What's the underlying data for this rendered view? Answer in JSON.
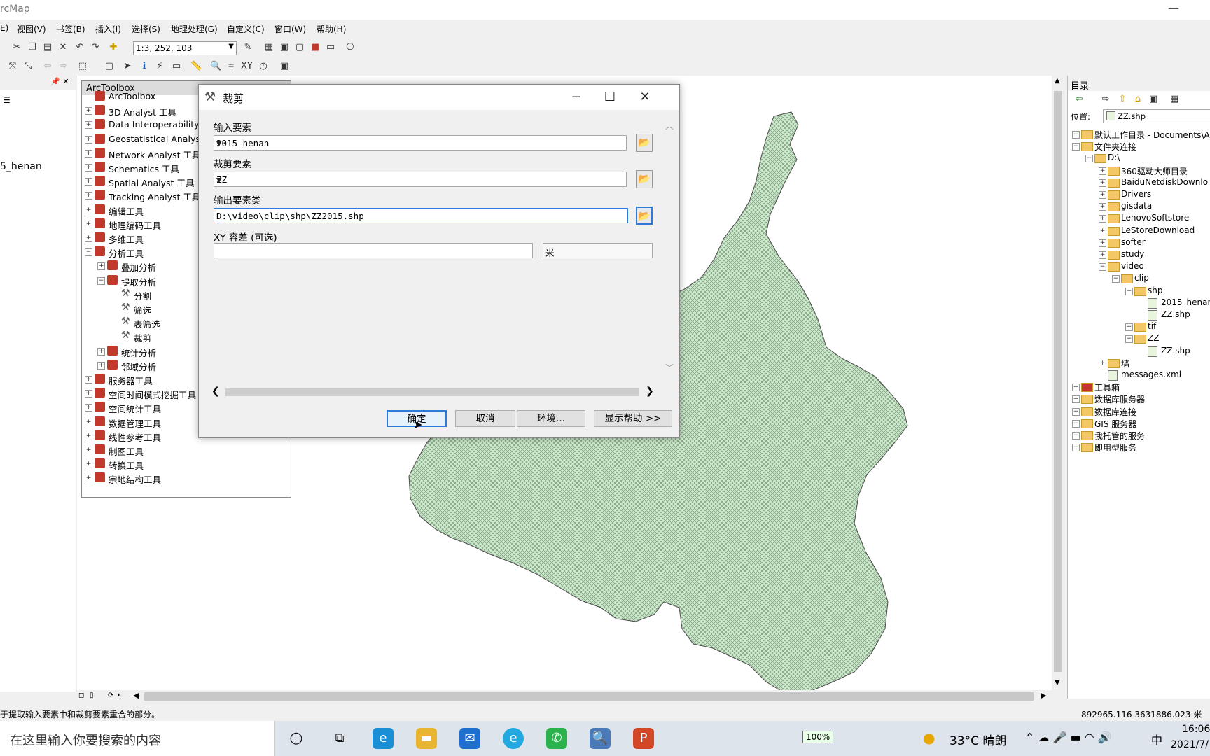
{
  "app": {
    "title": "rcMap",
    "minimize": "—"
  },
  "menu": [
    "E)",
    "视图(V)",
    "书签(B)",
    "插入(I)",
    "选择(S)",
    "地理处理(G)",
    "自定义(C)",
    "窗口(W)",
    "帮助(H)"
  ],
  "toolbar": {
    "scale": "1:3, 252, 103"
  },
  "left_panel": {
    "layer": "5_henan",
    "pin": "📌 ✕"
  },
  "toolbox": {
    "title": "ArcToolbox",
    "items": [
      {
        "label": "ArcToolbox",
        "level": 0,
        "expander": "",
        "kind": "box"
      },
      {
        "label": "3D Analyst 工具",
        "level": 0,
        "expander": "+",
        "kind": "box"
      },
      {
        "label": "Data Interoperability",
        "level": 0,
        "expander": "+",
        "kind": "box"
      },
      {
        "label": "Geostatistical Analys",
        "level": 0,
        "expander": "+",
        "kind": "box"
      },
      {
        "label": "Network Analyst 工具",
        "level": 0,
        "expander": "+",
        "kind": "box"
      },
      {
        "label": "Schematics 工具",
        "level": 0,
        "expander": "+",
        "kind": "box"
      },
      {
        "label": "Spatial Analyst 工具",
        "level": 0,
        "expander": "+",
        "kind": "box"
      },
      {
        "label": "Tracking Analyst 工具",
        "level": 0,
        "expander": "+",
        "kind": "box"
      },
      {
        "label": "编辑工具",
        "level": 0,
        "expander": "+",
        "kind": "box"
      },
      {
        "label": "地理编码工具",
        "level": 0,
        "expander": "+",
        "kind": "box"
      },
      {
        "label": "多维工具",
        "level": 0,
        "expander": "+",
        "kind": "box"
      },
      {
        "label": "分析工具",
        "level": 0,
        "expander": "−",
        "kind": "box"
      },
      {
        "label": "叠加分析",
        "level": 1,
        "expander": "+",
        "kind": "box"
      },
      {
        "label": "提取分析",
        "level": 1,
        "expander": "−",
        "kind": "box"
      },
      {
        "label": "分割",
        "level": 2,
        "expander": "",
        "kind": "tool"
      },
      {
        "label": "筛选",
        "level": 2,
        "expander": "",
        "kind": "tool"
      },
      {
        "label": "表筛选",
        "level": 2,
        "expander": "",
        "kind": "tool"
      },
      {
        "label": "裁剪",
        "level": 2,
        "expander": "",
        "kind": "tool"
      },
      {
        "label": "统计分析",
        "level": 1,
        "expander": "+",
        "kind": "box"
      },
      {
        "label": "邻域分析",
        "level": 1,
        "expander": "+",
        "kind": "box"
      },
      {
        "label": "服务器工具",
        "level": 0,
        "expander": "+",
        "kind": "box"
      },
      {
        "label": "空间时间模式挖掘工具",
        "level": 0,
        "expander": "+",
        "kind": "box"
      },
      {
        "label": "空间统计工具",
        "level": 0,
        "expander": "+",
        "kind": "box"
      },
      {
        "label": "数据管理工具",
        "level": 0,
        "expander": "+",
        "kind": "box"
      },
      {
        "label": "线性参考工具",
        "level": 0,
        "expander": "+",
        "kind": "box"
      },
      {
        "label": "制图工具",
        "level": 0,
        "expander": "+",
        "kind": "box"
      },
      {
        "label": "转换工具",
        "level": 0,
        "expander": "+",
        "kind": "box"
      },
      {
        "label": "宗地结构工具",
        "level": 0,
        "expander": "+",
        "kind": "box"
      }
    ]
  },
  "dialog": {
    "title": "裁剪",
    "input_label": "输入要素",
    "input_value": "2015_henan",
    "clip_label": "裁剪要素",
    "clip_value": "ZZ",
    "output_label": "输出要素类",
    "output_value": "D:\\video\\clip\\shp\\ZZ2015.shp",
    "xy_label": "XY 容差 (可选)",
    "xy_value": "",
    "unit_value": "米",
    "buttons": {
      "ok": "确定",
      "cancel": "取消",
      "env": "环境...",
      "help": "显示帮助 >>"
    }
  },
  "catalog": {
    "title": "目录",
    "location_label": "位置:",
    "location_value": "ZZ.shp",
    "items": [
      {
        "label": "默认工作目录 - Documents\\A",
        "level": 0,
        "expander": "+",
        "kind": "folder"
      },
      {
        "label": "文件夹连接",
        "level": 0,
        "expander": "−",
        "kind": "folder"
      },
      {
        "label": "D:\\",
        "level": 1,
        "expander": "−",
        "kind": "folder"
      },
      {
        "label": "360驱动大师目录",
        "level": 2,
        "expander": "+",
        "kind": "folder"
      },
      {
        "label": "BaiduNetdiskDownlo",
        "level": 2,
        "expander": "+",
        "kind": "folder"
      },
      {
        "label": "Drivers",
        "level": 2,
        "expander": "+",
        "kind": "folder"
      },
      {
        "label": "gisdata",
        "level": 2,
        "expander": "+",
        "kind": "folder"
      },
      {
        "label": "LenovoSoftstore",
        "level": 2,
        "expander": "+",
        "kind": "folder"
      },
      {
        "label": "LeStoreDownload",
        "level": 2,
        "expander": "+",
        "kind": "folder"
      },
      {
        "label": "softer",
        "level": 2,
        "expander": "+",
        "kind": "folder"
      },
      {
        "label": "study",
        "level": 2,
        "expander": "+",
        "kind": "folder"
      },
      {
        "label": "video",
        "level": 2,
        "expander": "−",
        "kind": "folder"
      },
      {
        "label": "clip",
        "level": 3,
        "expander": "−",
        "kind": "folder"
      },
      {
        "label": "shp",
        "level": 4,
        "expander": "−",
        "kind": "folder"
      },
      {
        "label": "2015_henan",
        "level": 5,
        "expander": "",
        "kind": "file"
      },
      {
        "label": "ZZ.shp",
        "level": 5,
        "expander": "",
        "kind": "file"
      },
      {
        "label": "tif",
        "level": 4,
        "expander": "+",
        "kind": "folder"
      },
      {
        "label": "ZZ",
        "level": 4,
        "expander": "−",
        "kind": "folder"
      },
      {
        "label": "ZZ.shp",
        "level": 5,
        "expander": "",
        "kind": "file"
      },
      {
        "label": "墙",
        "level": 2,
        "expander": "+",
        "kind": "folder"
      },
      {
        "label": "messages.xml",
        "level": 2,
        "expander": "",
        "kind": "file"
      },
      {
        "label": "工具箱",
        "level": 0,
        "expander": "+",
        "kind": "box"
      },
      {
        "label": "数据库服务器",
        "level": 0,
        "expander": "+",
        "kind": "folder"
      },
      {
        "label": "数据库连接",
        "level": 0,
        "expander": "+",
        "kind": "folder"
      },
      {
        "label": "GIS 服务器",
        "level": 0,
        "expander": "+",
        "kind": "folder"
      },
      {
        "label": "我托管的服务",
        "level": 0,
        "expander": "+",
        "kind": "folder"
      },
      {
        "label": "即用型服务",
        "level": 0,
        "expander": "+",
        "kind": "folder"
      }
    ]
  },
  "status": {
    "message": "于提取输入要素中和裁剪要素重合的部分。",
    "coords": "892965.116  3631886.023 米"
  },
  "taskbar": {
    "search_placeholder": "在这里输入你要搜索的内容",
    "battery": "100%",
    "weather": "33°C 晴朗",
    "ime": "中",
    "time": "16:06",
    "date": "2021/7/"
  },
  "colors": {
    "map_fill": "#c8ecc8",
    "map_stroke": "#4a4a4a",
    "accent": "#2f7ad8"
  }
}
